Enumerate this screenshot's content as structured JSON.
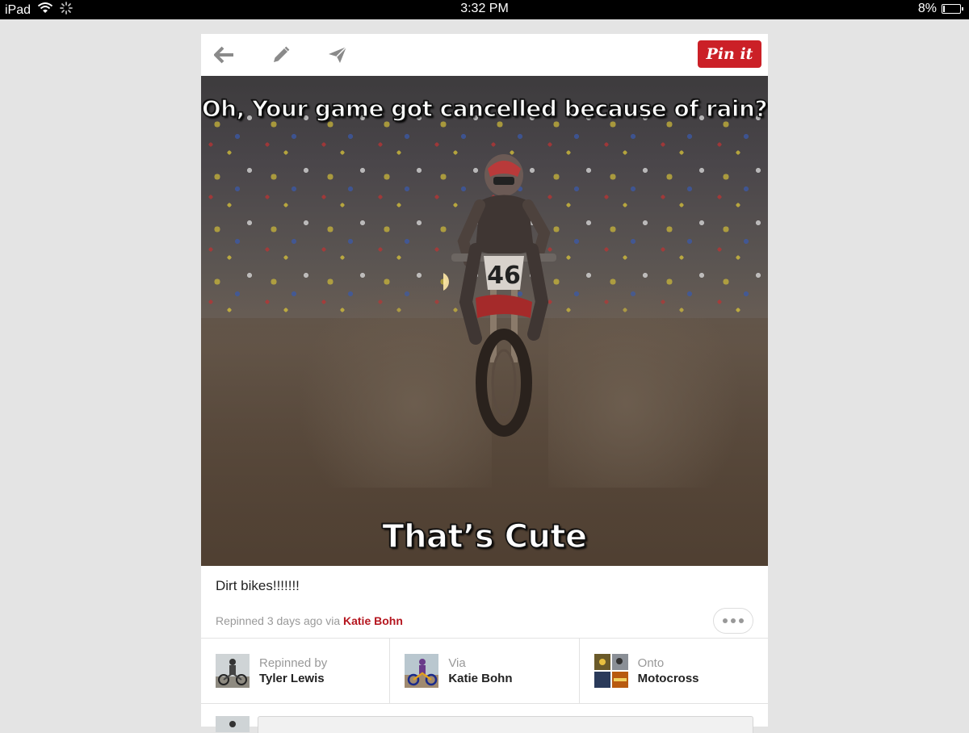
{
  "status_bar": {
    "device": "iPad",
    "time": "3:32 PM",
    "battery": "8%",
    "battery_level": 0.08
  },
  "toolbar": {
    "back_icon": "arrow-left-icon",
    "edit_icon": "pencil-icon",
    "send_icon": "paper-plane-icon",
    "pin_label": "Pin it",
    "pin_color": "#cb2027"
  },
  "image": {
    "top_caption": "Oh, Your game got cancelled because of rain?",
    "bottom_caption": "That’s Cute",
    "bike_number": "46"
  },
  "pin": {
    "description": "Dirt bikes!!!!!!!",
    "meta_prefix": "Repinned 3 days ago via ",
    "meta_via": "Katie Bohn"
  },
  "attribution": [
    {
      "label": "Repinned by",
      "name": "Tyler Lewis"
    },
    {
      "label": "Via",
      "name": "Katie Bohn"
    },
    {
      "label": "Onto",
      "name": "Motocross"
    }
  ]
}
